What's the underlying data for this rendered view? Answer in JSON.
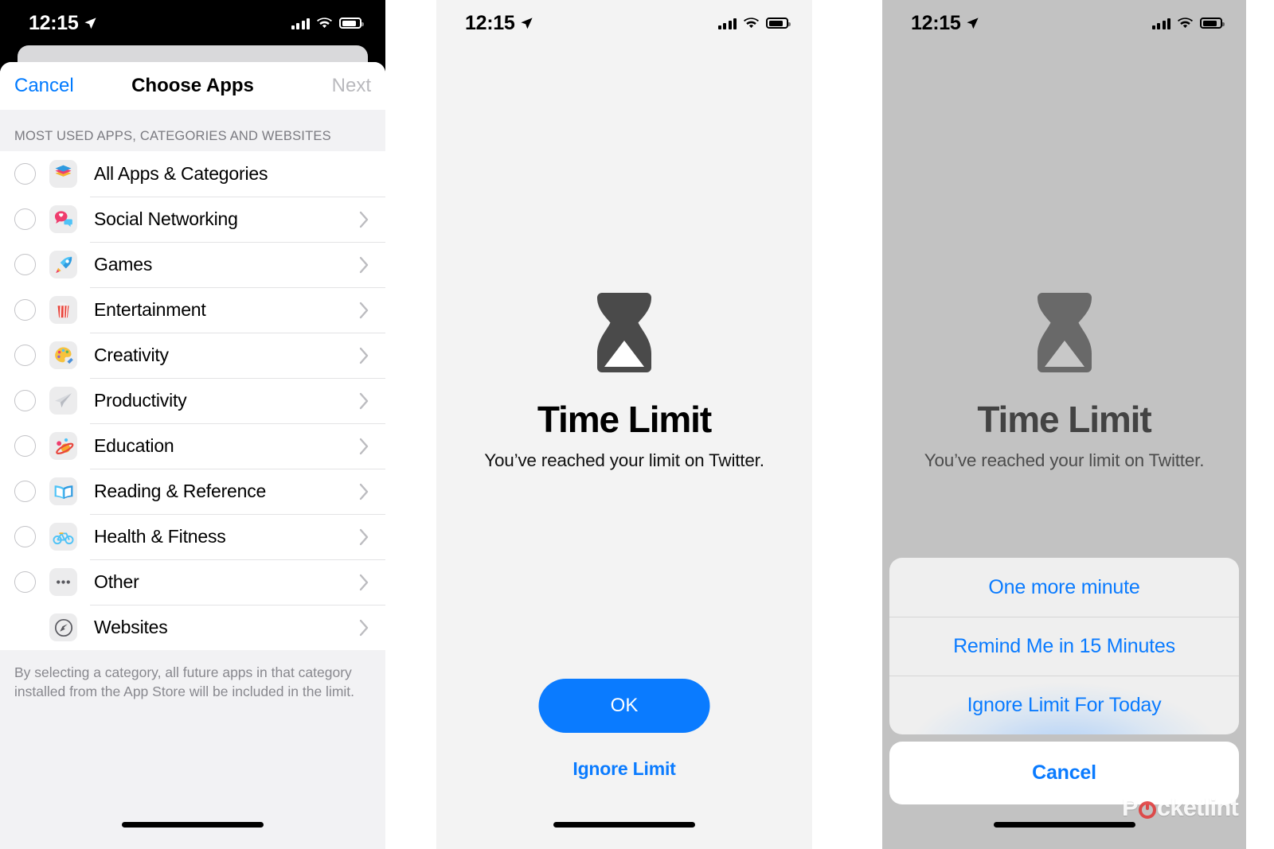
{
  "status_bar": {
    "time": "12:15",
    "icons": [
      "location-arrow-icon",
      "cellular-bars-icon",
      "wifi-icon",
      "battery-icon"
    ]
  },
  "colors": {
    "accent_blue": "#0a7bff",
    "nav_blue": "#007aff",
    "disabled_gray": "#b9b9bd",
    "sheet_bg": "#f2f2f4",
    "dim_overlay": "#8c8c8c"
  },
  "panel1": {
    "nav": {
      "cancel_label": "Cancel",
      "title": "Choose Apps",
      "next_label": "Next"
    },
    "section_header": "MOST USED APPS, CATEGORIES AND WEBSITES",
    "rows": [
      {
        "label": "All Apps & Categories",
        "icon": "stacked-layers-icon",
        "has_radio": true,
        "has_chevron": false
      },
      {
        "label": "Social Networking",
        "icon": "chat-bubbles-heart-icon",
        "has_radio": true,
        "has_chevron": true
      },
      {
        "label": "Games",
        "icon": "rocket-icon",
        "has_radio": true,
        "has_chevron": true
      },
      {
        "label": "Entertainment",
        "icon": "popcorn-icon",
        "has_radio": true,
        "has_chevron": true
      },
      {
        "label": "Creativity",
        "icon": "paint-palette-icon",
        "has_radio": true,
        "has_chevron": true
      },
      {
        "label": "Productivity",
        "icon": "paper-plane-icon",
        "has_radio": true,
        "has_chevron": true
      },
      {
        "label": "Education",
        "icon": "atom-planet-icon",
        "has_radio": true,
        "has_chevron": true
      },
      {
        "label": "Reading & Reference",
        "icon": "open-book-icon",
        "has_radio": true,
        "has_chevron": true
      },
      {
        "label": "Health & Fitness",
        "icon": "bicycle-icon",
        "has_radio": true,
        "has_chevron": true
      },
      {
        "label": "Other",
        "icon": "ellipsis-icon",
        "has_radio": true,
        "has_chevron": true
      },
      {
        "label": "Websites",
        "icon": "compass-safari-icon",
        "has_radio": false,
        "has_chevron": true
      }
    ],
    "footer_note": "By selecting a category, all future apps in that category installed from the App Store will be included in the limit."
  },
  "panel2": {
    "icon": "hourglass-icon",
    "title": "Time Limit",
    "subtitle": "You’ve reached your limit on Twitter.",
    "ok_label": "OK",
    "ignore_label": "Ignore Limit"
  },
  "panel3": {
    "icon": "hourglass-icon",
    "title": "Time Limit",
    "subtitle": "You’ve reached your limit on Twitter.",
    "action_sheet": {
      "options": [
        "One more minute",
        "Remind Me in 15 Minutes",
        "Ignore Limit For Today"
      ],
      "cancel_label": "Cancel"
    }
  },
  "watermark": {
    "text_before": "P",
    "text_after": "cketlint"
  }
}
